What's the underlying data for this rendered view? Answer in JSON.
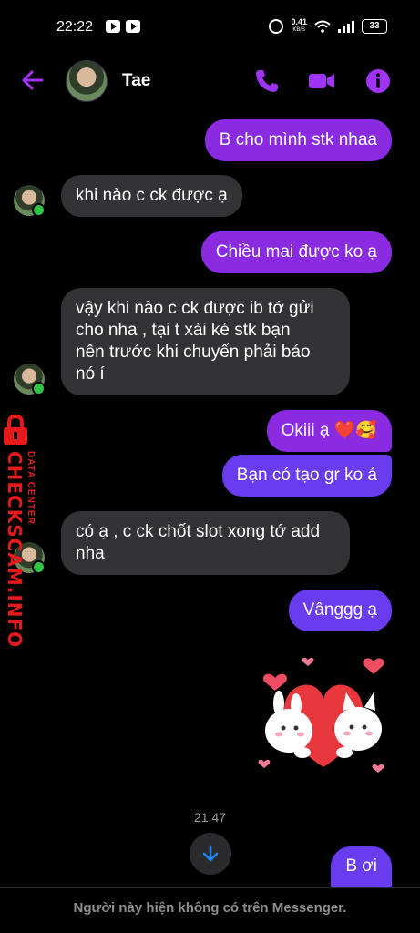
{
  "status_bar": {
    "time": "22:22",
    "net_speed": "0.41",
    "net_unit": "KB/S",
    "battery": "33"
  },
  "header": {
    "contact_name": "Tae",
    "accent": "#a033f5"
  },
  "messages": [
    {
      "side": "out",
      "lines": [
        "B cho mình stk nhaa"
      ]
    },
    {
      "side": "in",
      "lines": [
        "khi nào c ck được ạ"
      ]
    },
    {
      "side": "out",
      "lines": [
        "Chiều mai được ko ạ"
      ]
    },
    {
      "side": "in",
      "lines": [
        "vậy khi nào c ck được ib tớ gửi",
        "cho nha , tại t xài ké stk bạn",
        "nên trước khi chuyển phải báo",
        "nó í"
      ]
    },
    {
      "side": "out",
      "lines": [
        "Okiii ạ ❤️🥰"
      ]
    },
    {
      "side": "out",
      "lines": [
        "Bạn có tạo gr ko á"
      ]
    },
    {
      "side": "in",
      "lines": [
        "có ạ , c ck chốt slot xong tớ add",
        "nha"
      ]
    },
    {
      "side": "out",
      "lines": [
        "Vânggg ạ"
      ]
    },
    {
      "side": "out",
      "lines": [
        "B ơi"
      ]
    }
  ],
  "watermark": {
    "main": "CHECKSCAM.INFO",
    "sub": "DATA CENTER"
  },
  "timestamp": "21:47",
  "footer_notice": "Người này hiện không có trên Messenger.",
  "colors": {
    "outgoing_bubble": "#8a2be2",
    "outgoing_bubble_alt": "#6a3cf0",
    "incoming_bubble": "#333335",
    "online_dot": "#31c24a"
  }
}
